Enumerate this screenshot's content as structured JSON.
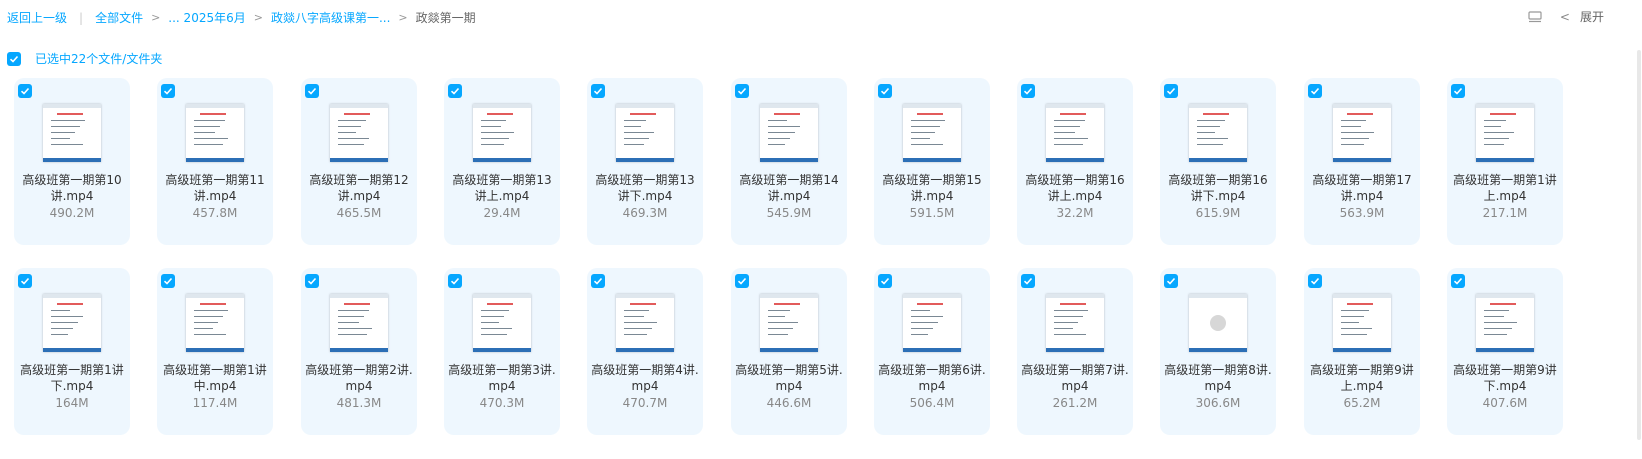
{
  "breadcrumb": {
    "back": "返回上一级",
    "root": "全部文件",
    "ellipsis_item": "... 2025年6月",
    "folder": "政燚八字高级课第一...",
    "current": "政燚第一期"
  },
  "toolbar": {
    "expand_label": "展开",
    "list_view_icon": "list-view-icon"
  },
  "selection": {
    "summary": "已选中22个文件/文件夹"
  },
  "colors": {
    "accent": "#06a7ff",
    "card_bg": "#eef7fe"
  },
  "files": [
    {
      "name": "高级班第一期第10讲.mp4",
      "size": "490.2M",
      "selected": true
    },
    {
      "name": "高级班第一期第11讲.mp4",
      "size": "457.8M",
      "selected": true
    },
    {
      "name": "高级班第一期第12讲.mp4",
      "size": "465.5M",
      "selected": true
    },
    {
      "name": "高级班第一期第13讲上.mp4",
      "size": "29.4M",
      "selected": true
    },
    {
      "name": "高级班第一期第13讲下.mp4",
      "size": "469.3M",
      "selected": true
    },
    {
      "name": "高级班第一期第14讲.mp4",
      "size": "545.9M",
      "selected": true
    },
    {
      "name": "高级班第一期第15讲.mp4",
      "size": "591.5M",
      "selected": true
    },
    {
      "name": "高级班第一期第16讲上.mp4",
      "size": "32.2M",
      "selected": true
    },
    {
      "name": "高级班第一期第16讲下.mp4",
      "size": "615.9M",
      "selected": true
    },
    {
      "name": "高级班第一期第17讲.mp4",
      "size": "563.9M",
      "selected": true
    },
    {
      "name": "高级班第一期第1讲上.mp4",
      "size": "217.1M",
      "selected": true
    },
    {
      "name": "高级班第一期第1讲下.mp4",
      "size": "164M",
      "selected": true
    },
    {
      "name": "高级班第一期第1讲中.mp4",
      "size": "117.4M",
      "selected": true
    },
    {
      "name": "高级班第一期第2讲.mp4",
      "size": "481.3M",
      "selected": true
    },
    {
      "name": "高级班第一期第3讲.mp4",
      "size": "470.3M",
      "selected": true
    },
    {
      "name": "高级班第一期第4讲.mp4",
      "size": "470.7M",
      "selected": true
    },
    {
      "name": "高级班第一期第5讲.mp4",
      "size": "446.6M",
      "selected": true
    },
    {
      "name": "高级班第一期第6讲.mp4",
      "size": "506.4M",
      "selected": true
    },
    {
      "name": "高级班第一期第7讲.mp4",
      "size": "261.2M",
      "selected": true
    },
    {
      "name": "高级班第一期第8讲.mp4",
      "size": "306.6M",
      "selected": true
    },
    {
      "name": "高级班第一期第9讲上.mp4",
      "size": "65.2M",
      "selected": true
    },
    {
      "name": "高级班第一期第9讲下.mp4",
      "size": "407.6M",
      "selected": true
    }
  ]
}
